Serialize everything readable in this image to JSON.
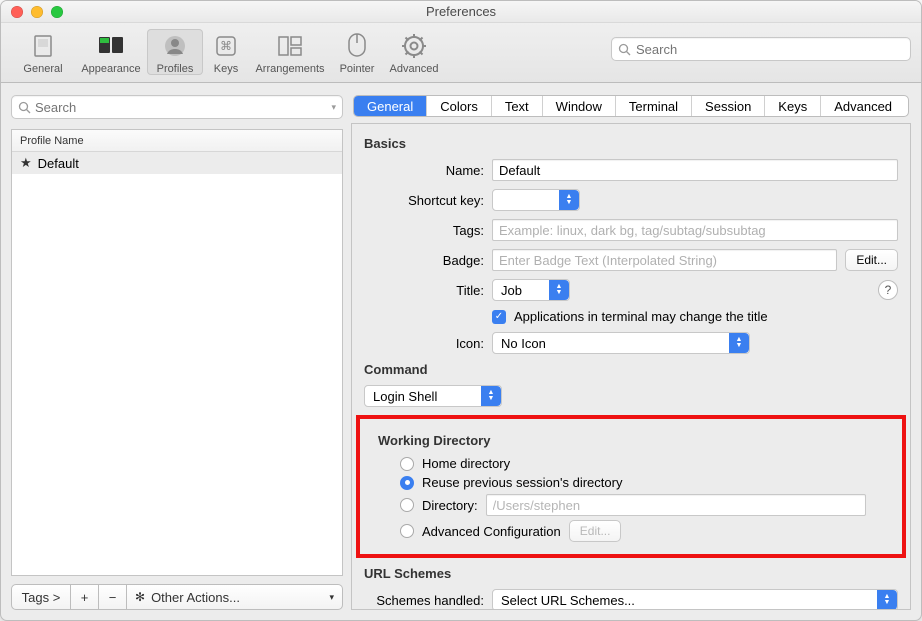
{
  "window": {
    "title": "Preferences"
  },
  "toolbar": {
    "search_placeholder": "Search",
    "items": [
      {
        "label": "General"
      },
      {
        "label": "Appearance"
      },
      {
        "label": "Profiles"
      },
      {
        "label": "Keys"
      },
      {
        "label": "Arrangements"
      },
      {
        "label": "Pointer"
      },
      {
        "label": "Advanced"
      }
    ]
  },
  "sidebar": {
    "search_placeholder": "Search",
    "header": "Profile Name",
    "rows": [
      {
        "name": "Default",
        "starred": true
      }
    ],
    "tags_button": "Tags >",
    "other_actions": "Other Actions..."
  },
  "tabs": [
    "General",
    "Colors",
    "Text",
    "Window",
    "Terminal",
    "Session",
    "Keys",
    "Advanced"
  ],
  "basics": {
    "heading": "Basics",
    "name_label": "Name:",
    "name_value": "Default",
    "shortcut_label": "Shortcut key:",
    "shortcut_value": "",
    "tags_label": "Tags:",
    "tags_placeholder": "Example: linux, dark bg, tag/subtag/subsubtag",
    "badge_label": "Badge:",
    "badge_placeholder": "Enter Badge Text (Interpolated String)",
    "edit_label": "Edit...",
    "title_label": "Title:",
    "title_value": "Job",
    "apps_change_title": "Applications in terminal may change the title",
    "icon_label": "Icon:",
    "icon_value": "No Icon"
  },
  "command": {
    "heading": "Command",
    "shell_value": "Login Shell"
  },
  "working_dir": {
    "heading": "Working Directory",
    "home": "Home directory",
    "reuse": "Reuse previous session's directory",
    "directory_label": "Directory:",
    "directory_value": "/Users/stephen",
    "advanced": "Advanced Configuration",
    "edit": "Edit..."
  },
  "url": {
    "heading": "URL Schemes",
    "label": "Schemes handled:",
    "value": "Select URL Schemes..."
  }
}
